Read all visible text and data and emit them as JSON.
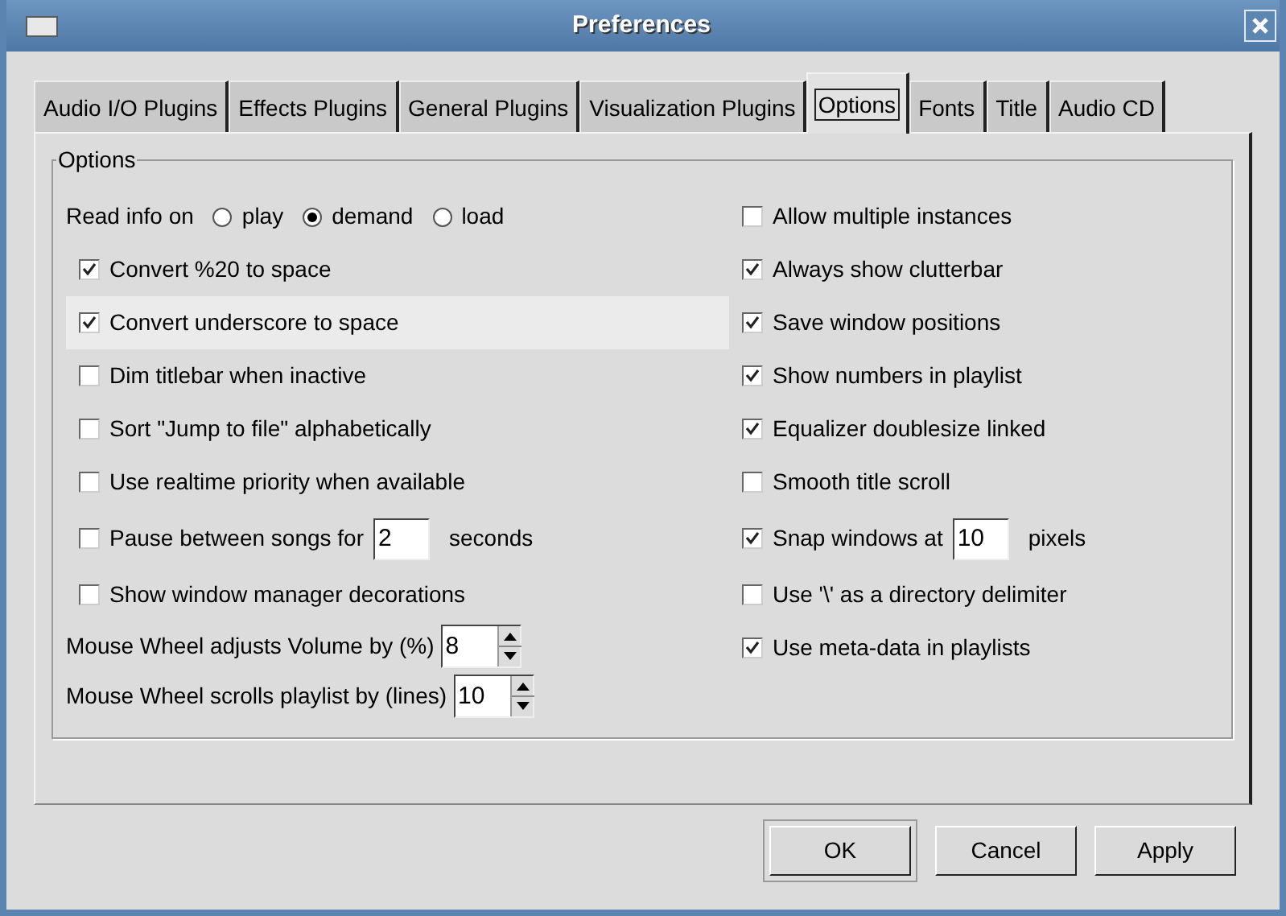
{
  "window": {
    "title": "Preferences"
  },
  "tabs": [
    {
      "label": "Audio I/O Plugins",
      "selected": false
    },
    {
      "label": "Effects Plugins",
      "selected": false
    },
    {
      "label": "General Plugins",
      "selected": false
    },
    {
      "label": "Visualization Plugins",
      "selected": false
    },
    {
      "label": "Options",
      "selected": true
    },
    {
      "label": "Fonts",
      "selected": false
    },
    {
      "label": "Title",
      "selected": false
    },
    {
      "label": "Audio CD",
      "selected": false
    }
  ],
  "group": {
    "title": "Options",
    "left": [
      {
        "kind": "radio",
        "label": "Read info on",
        "options": [
          {
            "label": "play",
            "selected": false
          },
          {
            "label": "demand",
            "selected": true
          },
          {
            "label": "load",
            "selected": false
          }
        ]
      },
      {
        "kind": "checkbox",
        "label": "Convert %20 to space",
        "checked": true,
        "highlighted": false
      },
      {
        "kind": "checkbox",
        "label": "Convert underscore to space",
        "checked": true,
        "highlighted": true
      },
      {
        "kind": "checkbox",
        "label": "Dim titlebar when inactive",
        "checked": false,
        "highlighted": false
      },
      {
        "kind": "checkbox",
        "label": "Sort \"Jump to file\" alphabetically",
        "checked": false,
        "highlighted": false
      },
      {
        "kind": "checkbox",
        "label": "Use realtime priority when available",
        "checked": false,
        "highlighted": false
      },
      {
        "kind": "checkbox_field",
        "label": "Pause between songs for",
        "checked": false,
        "value": "2",
        "suffix": "seconds"
      },
      {
        "kind": "checkbox",
        "label": "Show window manager decorations",
        "checked": false,
        "highlighted": false
      },
      {
        "kind": "spin",
        "label": "Mouse Wheel adjusts Volume by (%)",
        "value": "8"
      },
      {
        "kind": "spin",
        "label": "Mouse Wheel scrolls playlist by (lines)",
        "value": "10"
      }
    ],
    "right": [
      {
        "kind": "checkbox",
        "label": "Allow multiple instances",
        "checked": false,
        "highlighted": false
      },
      {
        "kind": "checkbox",
        "label": "Always show clutterbar",
        "checked": true,
        "highlighted": false
      },
      {
        "kind": "checkbox",
        "label": "Save window positions",
        "checked": true,
        "highlighted": false
      },
      {
        "kind": "checkbox",
        "label": "Show numbers in playlist",
        "checked": true,
        "highlighted": false
      },
      {
        "kind": "checkbox",
        "label": "Equalizer doublesize linked",
        "checked": true,
        "highlighted": false
      },
      {
        "kind": "checkbox",
        "label": "Smooth title scroll",
        "checked": false,
        "highlighted": false
      },
      {
        "kind": "checkbox_field",
        "label": "Snap windows at",
        "checked": true,
        "value": "10",
        "suffix": "pixels"
      },
      {
        "kind": "checkbox",
        "label": "Use '\\' as a directory delimiter",
        "checked": false,
        "highlighted": false
      },
      {
        "kind": "checkbox",
        "label": "Use meta-data in playlists",
        "checked": true,
        "highlighted": false
      }
    ]
  },
  "buttons": [
    {
      "label": "OK",
      "default": true
    },
    {
      "label": "Cancel",
      "default": false
    },
    {
      "label": "Apply",
      "default": false
    }
  ]
}
